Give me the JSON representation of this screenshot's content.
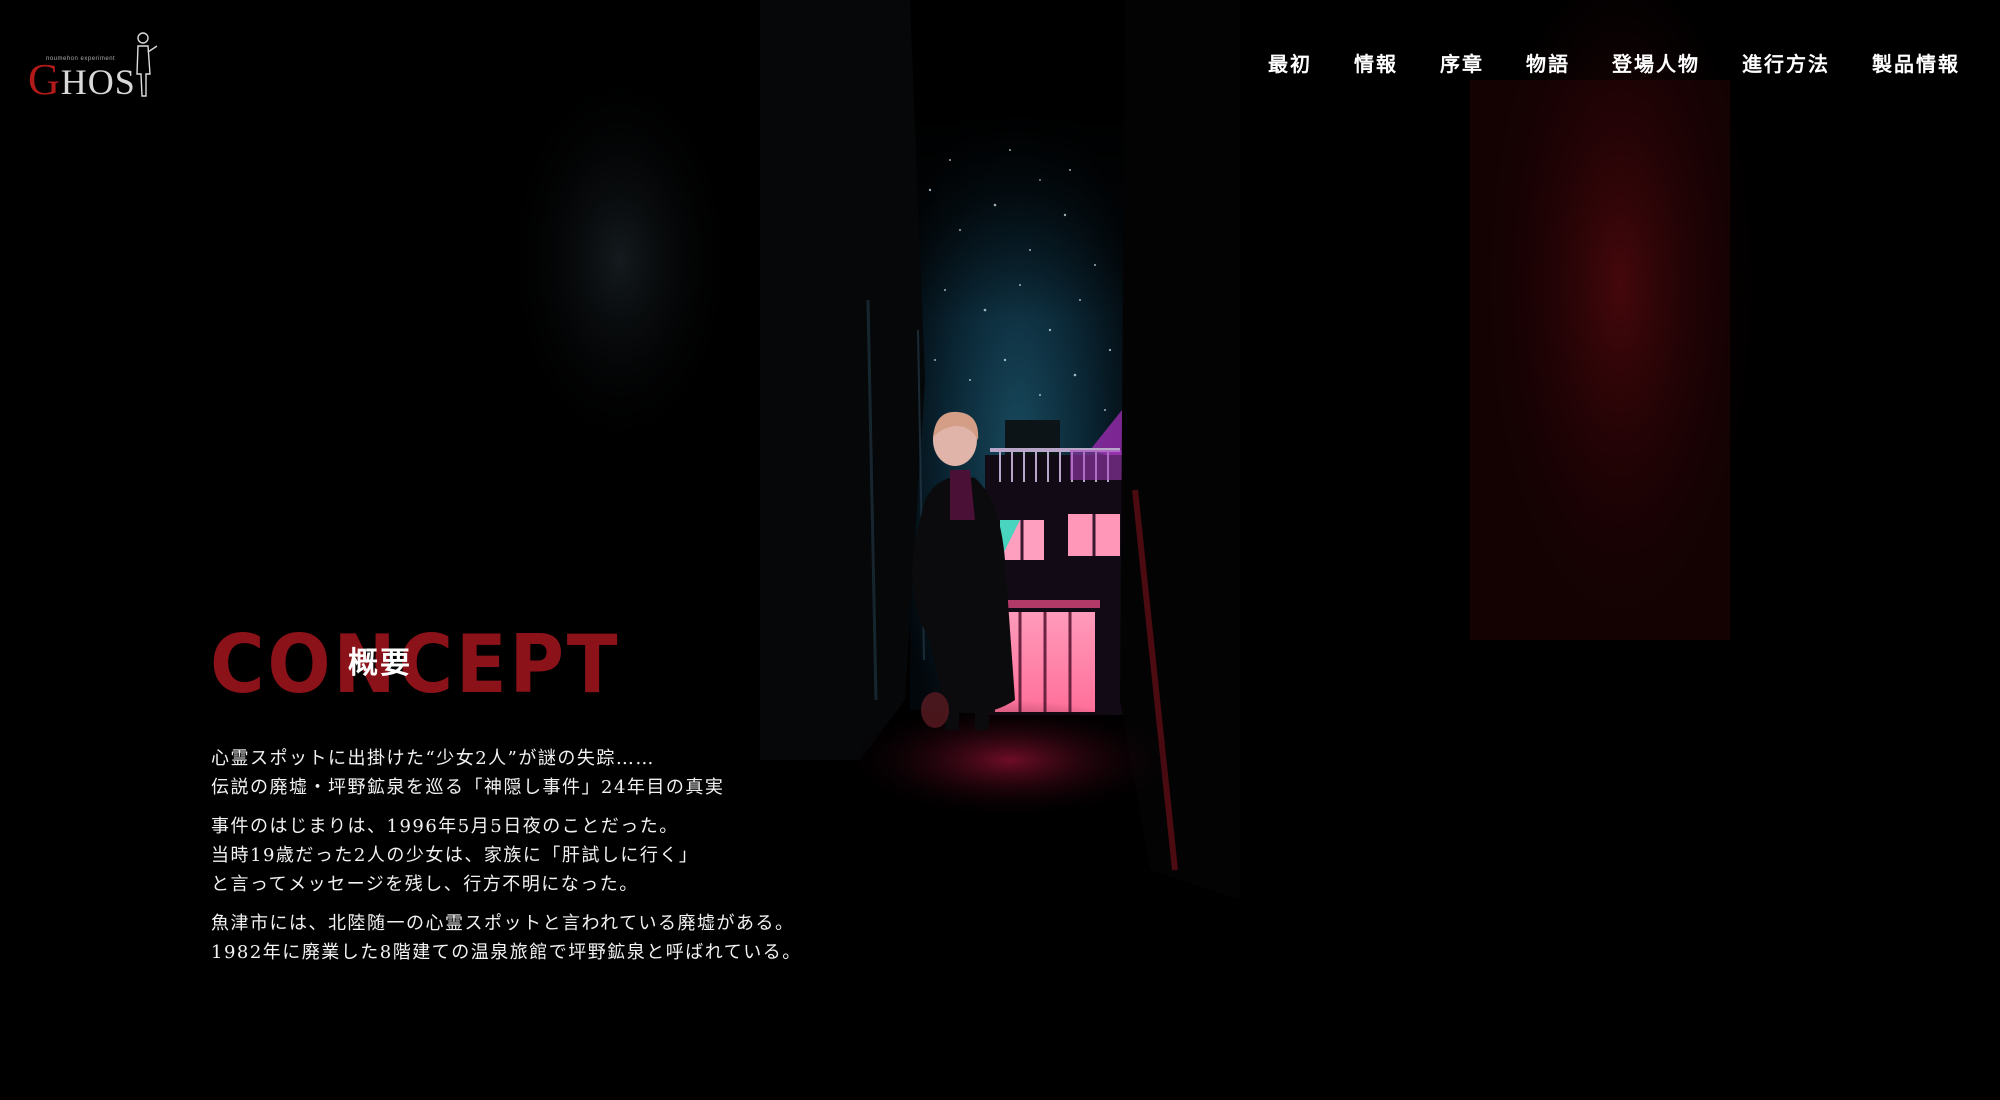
{
  "logo": {
    "text_initial": "G",
    "text_rest": "HOS",
    "tagline": "noumehon experiment"
  },
  "nav": {
    "items": [
      {
        "label": "最初"
      },
      {
        "label": "情報"
      },
      {
        "label": "序章"
      },
      {
        "label": "物語"
      },
      {
        "label": "登場人物"
      },
      {
        "label": "進行方法"
      },
      {
        "label": "製品情報"
      }
    ]
  },
  "concept": {
    "heading_en": "CONCEPT",
    "heading_ja": "概要",
    "paragraphs": [
      {
        "lines": [
          "心霊スポットに出掛けた“少女2人”が謎の失踪……",
          "伝説の廃墟・坪野鉱泉を巡る「神隠し事件」24年目の真実"
        ]
      },
      {
        "lines": [
          "事件のはじまりは、1996年5月5日夜のことだった。",
          "当時19歳だった2人の少女は、家族に「肝試しに行く」",
          "と言ってメッセージを残し、行方不明になった。"
        ]
      },
      {
        "lines": [
          "魚津市には、北陸随一の心霊スポットと言われている廃墟がある。",
          "1982年に廃業した8階建ての温泉旅館で坪野鉱泉と呼ばれている。"
        ]
      }
    ]
  },
  "colors": {
    "background": "#000000",
    "accent_red": "#8c1219",
    "window_pink": "#ff8fb0",
    "window_teal": "#4fd3c4",
    "sky": "#0c2a3a"
  },
  "icons": {
    "logo_figure": "standing-person-icon"
  }
}
